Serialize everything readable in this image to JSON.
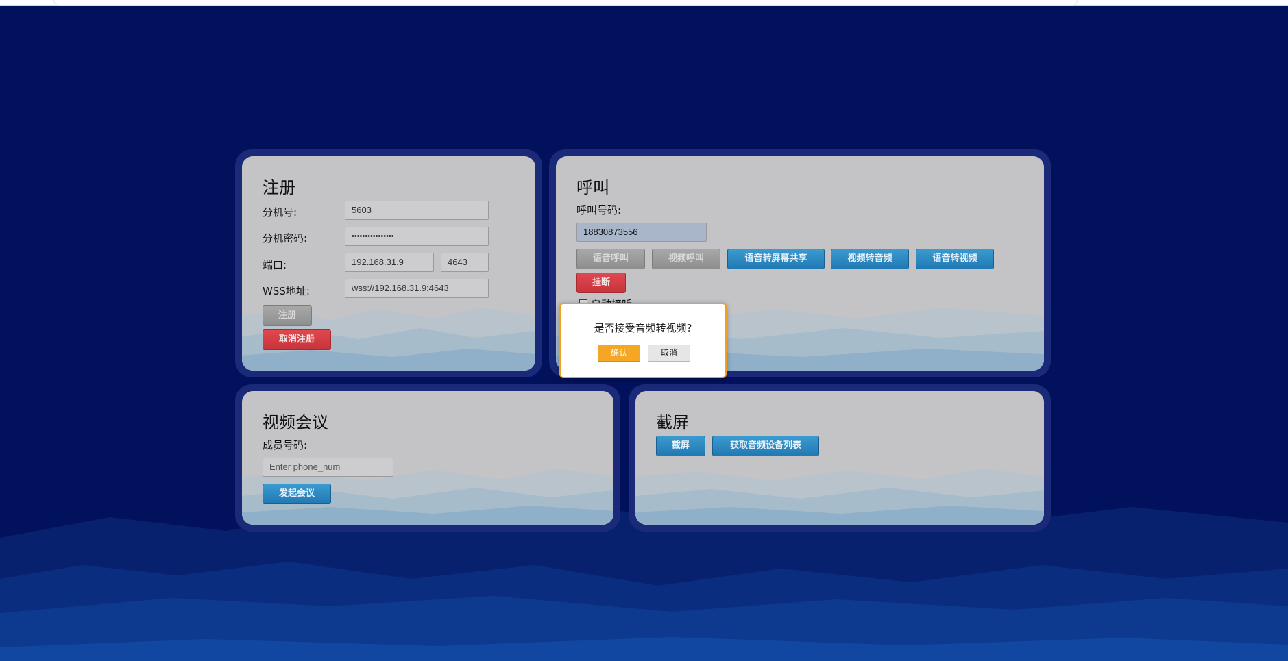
{
  "register": {
    "title": "注册",
    "ext_label": "分机号:",
    "ext_value": "5603",
    "password_label": "分机密码:",
    "password_value": "••••••••••••••••",
    "port_label": "端口:",
    "host_value": "192.168.31.9",
    "port_value": "4643",
    "wss_label": "WSS地址:",
    "wss_value": "wss://192.168.31.9:4643",
    "register_button": "注册",
    "unregister_button": "取消注册"
  },
  "call": {
    "title": "呼叫",
    "number_label": "呼叫号码:",
    "number_value": "18830873556",
    "voice_call_button": "语音呼叫",
    "video_call_button": "视频呼叫",
    "voice_to_screenshare_button": "语音转屏幕共享",
    "video_to_audio_button": "视频转音频",
    "voice_to_video_button": "语音转视频",
    "hangup_button": "挂断",
    "auto_answer_label": "自动接听"
  },
  "conference": {
    "title": "视频会议",
    "member_label": "成员号码:",
    "member_placeholder": "Enter phone_num",
    "start_button": "发起会议"
  },
  "screenshot": {
    "title": "截屏",
    "capture_button": "截屏",
    "audio_devices_button": "获取音频设备列表"
  },
  "dialog": {
    "message": "是否接受音频转视频?",
    "confirm_button": "确认",
    "cancel_button": "取消"
  },
  "colors": {
    "background": "#02115c",
    "panel": "#c4c4c6",
    "primary_button": "#2a86c0",
    "danger_button": "#d23e45",
    "dialog_accent": "#f5a623"
  }
}
